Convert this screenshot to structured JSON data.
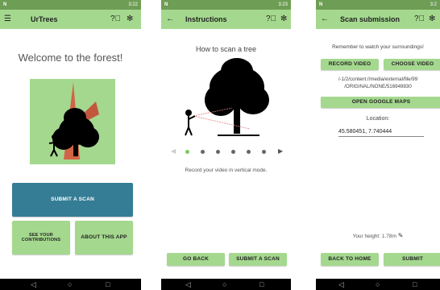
{
  "status": {
    "carrier_icon": "N",
    "time1": "3:22",
    "time2": "3:23",
    "time3": "3:2"
  },
  "screen1": {
    "title": "UrTrees",
    "welcome": "Welcome to the forest!",
    "submit_label": "SUBMIT A SCAN",
    "contrib_line1": "SEE YOUR",
    "contrib_line2": "CONTRIBUTIONS",
    "about_label": "ABOUT THIS APP"
  },
  "screen2": {
    "title": "Instructions",
    "heading": "How to scan a tree",
    "caption": "Record your video in vertical mode.",
    "back_label": "GO BACK",
    "submit_label": "SUBMIT A SCAN"
  },
  "screen3": {
    "title": "Scan submission",
    "reminder": "Remember to watch your surroundings!",
    "record_label": "RECORD VIDEO",
    "choose_label": "CHOOSE VIDEO",
    "path_line1": "/-1/2/content://media/external/file/99",
    "path_line2": "/ORIGINAL/NONE/516949830",
    "maps_label": "OPEN GOOGLE MAPS",
    "location_label": "Location:",
    "location_value": "45.580451, 7.740444",
    "height_text": "Your height: 1.78m",
    "home_label": "BACK TO HOME",
    "submit_label": "SUBMIT"
  },
  "colors": {
    "status": "#6e9d55",
    "appbar": "#a4d88e",
    "button": "#a4d88e",
    "primary": "#357d95"
  },
  "icons": [
    "menu-icon",
    "help-icon",
    "settings-icon",
    "back-arrow-icon",
    "edit-icon",
    "nav-back-icon",
    "nav-home-icon",
    "nav-recents-icon"
  ]
}
